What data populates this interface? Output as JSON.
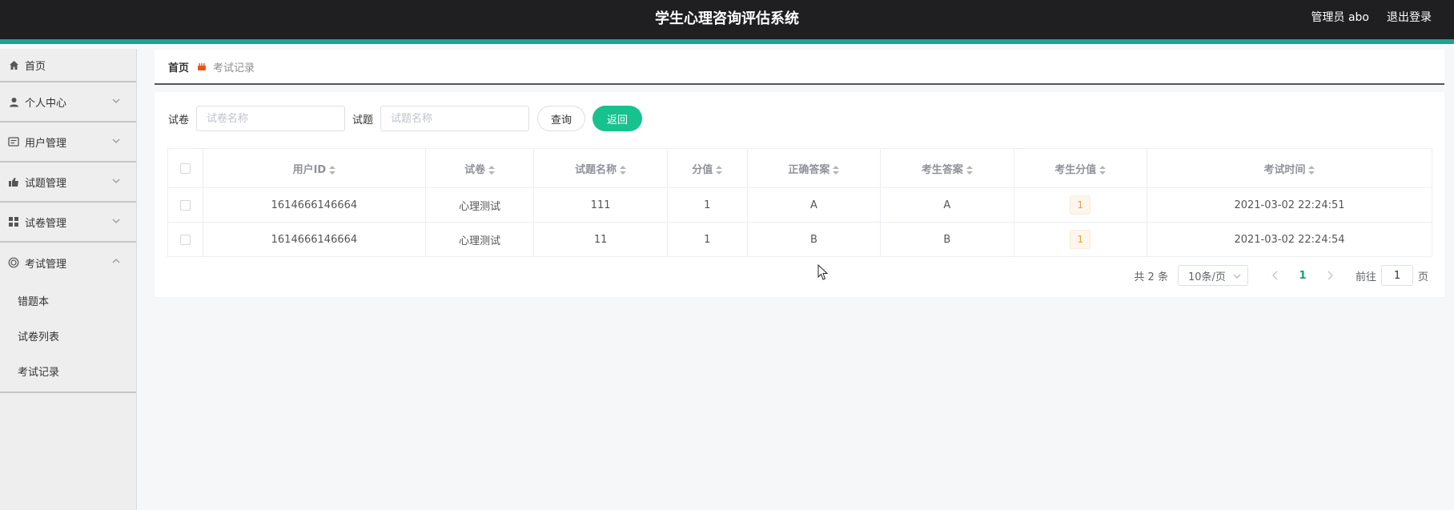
{
  "header": {
    "title": "学生心理咨询评估系统",
    "user": "管理员 abo",
    "logout": "退出登录"
  },
  "sidebar": {
    "items": [
      {
        "label": "首页",
        "icon": "home-icon"
      },
      {
        "label": "个人中心",
        "icon": "user-icon"
      },
      {
        "label": "用户管理",
        "icon": "id-card-icon"
      },
      {
        "label": "试题管理",
        "icon": "thumb-icon"
      },
      {
        "label": "试卷管理",
        "icon": "grid-icon"
      },
      {
        "label": "考试管理",
        "icon": "circle-icon"
      }
    ],
    "submenu": [
      "错题本",
      "试卷列表",
      "考试记录"
    ]
  },
  "breadcrumb": {
    "home": "首页",
    "current": "考试记录"
  },
  "search": {
    "paper_label": "试卷",
    "paper_placeholder": "试卷名称",
    "question_label": "试题",
    "question_placeholder": "试题名称",
    "query": "查询",
    "back": "返回"
  },
  "table": {
    "headers": [
      "用户ID",
      "试卷",
      "试题名称",
      "分值",
      "正确答案",
      "考生答案",
      "考生分值",
      "考试时间"
    ],
    "rows": [
      [
        "1614666146664",
        "心理测试",
        "111",
        "1",
        "A",
        "A",
        "1",
        "2021-03-02 22:24:51"
      ],
      [
        "1614666146664",
        "心理测试",
        "11",
        "1",
        "B",
        "B",
        "1",
        "2021-03-02 22:24:54"
      ]
    ]
  },
  "pager": {
    "total": "共 2 条",
    "size": "10条/页",
    "page": "1",
    "goto": "前往",
    "goto_value": "1",
    "page_unit": "页"
  }
}
